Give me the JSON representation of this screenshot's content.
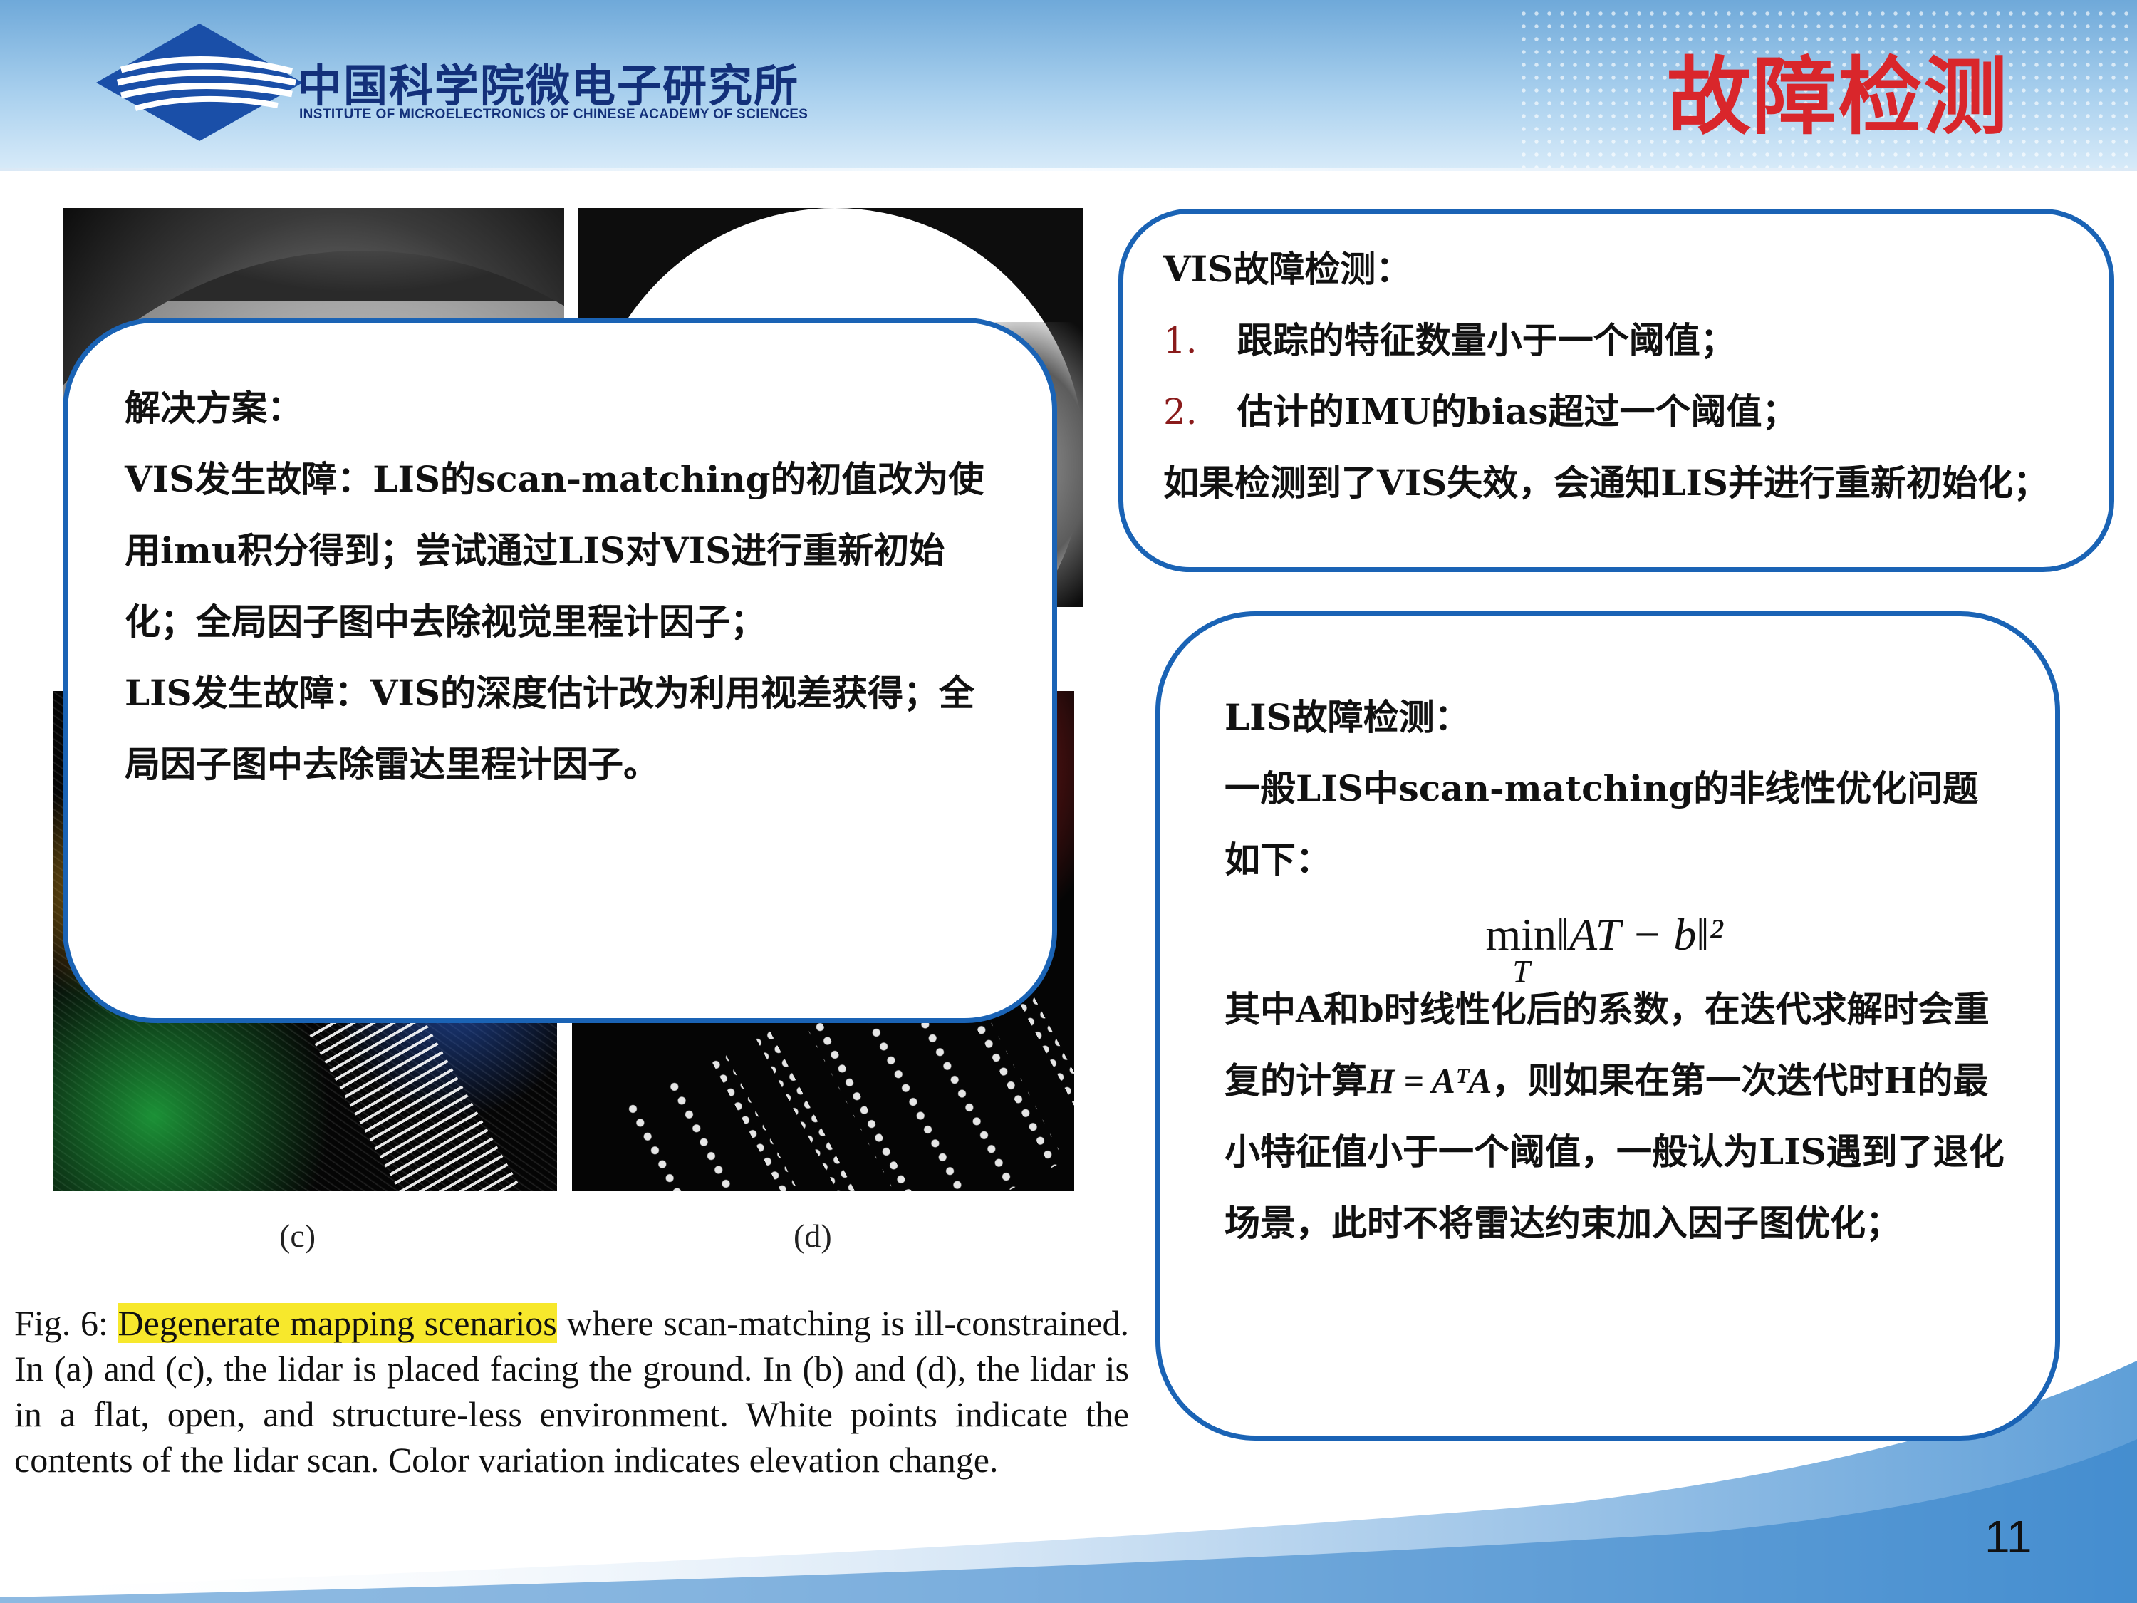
{
  "header": {
    "org_cn": "中国科学院微电子研究所",
    "org_en": "INSTITUTE OF MICROELECTRONICS OF CHINESE ACADEMY OF SCIENCES",
    "slide_title": "故障检测",
    "logo_icon": "ime-cas-logo-icon",
    "colors": {
      "brand_blue": "#1a63b5",
      "title_red": "#d9262b"
    }
  },
  "figure": {
    "sub_labels": [
      "(c)",
      "(d)"
    ],
    "caption_prefix": "Fig. 6: ",
    "caption_highlight": "Degenerate mapping scenarios",
    "caption_rest": " where scan-matching is ill-constrained. In (a) and (c), the lidar is placed facing the ground. In (b) and (d), the lidar is in a flat, open, and structure-less environment. White points indicate the contents of the lidar scan. Color variation indicates elevation change."
  },
  "solution_box": {
    "title": "解决方案：",
    "p1": "VIS发生故障：LIS的scan-matching的初值改为使用imu积分得到；尝试通过LIS对VIS进行重新初始化；全局因子图中去除视觉里程计因子；",
    "p2": "LIS发生故障：VIS的深度估计改为利用视差获得；全局因子图中去除雷达里程计因子。"
  },
  "vis_box": {
    "title": "VIS故障检测：",
    "items": [
      {
        "num": "1.",
        "text": "跟踪的特征数量小于一个阈值；"
      },
      {
        "num": "2.",
        "text": "估计的IMU的bias超过一个阈值；"
      }
    ],
    "footer": "如果检测到了VIS失效，会通知LIS并进行重新初始化；"
  },
  "lis_box": {
    "title": "LIS故障检测：",
    "intro": "一般LIS中scan-matching的非线性优化问题如下：",
    "formula_min": "min",
    "formula_sub": "T",
    "formula_body": "‖AT − b‖²",
    "body_pre": "其中A和b时线性化后的系数，在迭代求解时会重复的计算",
    "body_formula": "H = AᵀA",
    "body_post": "，则如果在第一次迭代时H的最小特征值小于一个阈值，一般认为LIS遇到了退化场景，此时不将雷达约束加入因子图优化；"
  },
  "page_number": "11"
}
